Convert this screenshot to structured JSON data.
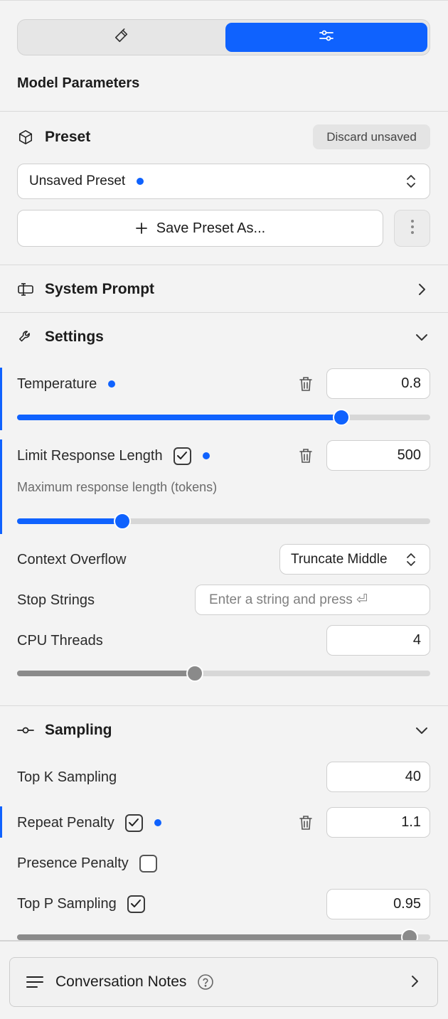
{
  "toggle": {
    "left_icon": "hammer-icon",
    "right_icon": "sliders-icon",
    "active": "right"
  },
  "header": {
    "title": "Model Parameters"
  },
  "preset": {
    "heading": "Preset",
    "discard_label": "Discard unsaved",
    "selected": "Unsaved Preset",
    "save_label": "Save Preset As..."
  },
  "system_prompt": {
    "heading": "System Prompt"
  },
  "settings": {
    "heading": "Settings",
    "temperature": {
      "label": "Temperature",
      "value": "0.8",
      "slider_fraction": 0.785
    },
    "limit_length": {
      "label": "Limit Response Length",
      "checked": true,
      "value": "500",
      "description": "Maximum response length (tokens)",
      "slider_fraction": 0.255
    },
    "context_overflow": {
      "label": "Context Overflow",
      "selected": "Truncate Middle"
    },
    "stop_strings": {
      "label": "Stop Strings",
      "placeholder": "Enter a string and press ⏎"
    },
    "cpu_threads": {
      "label": "CPU Threads",
      "value": "4",
      "slider_fraction": 0.43
    }
  },
  "sampling": {
    "heading": "Sampling",
    "top_k": {
      "label": "Top K Sampling",
      "value": "40"
    },
    "repeat_penalty": {
      "label": "Repeat Penalty",
      "checked": true,
      "value": "1.1"
    },
    "presence_penalty": {
      "label": "Presence Penalty",
      "checked": false
    },
    "top_p": {
      "label": "Top P Sampling",
      "checked": true,
      "value": "0.95",
      "slider_fraction": 0.95
    }
  },
  "notes": {
    "label": "Conversation Notes"
  },
  "colors": {
    "accent": "#0f62fe",
    "neutral_fill": "#8a8a8a"
  }
}
